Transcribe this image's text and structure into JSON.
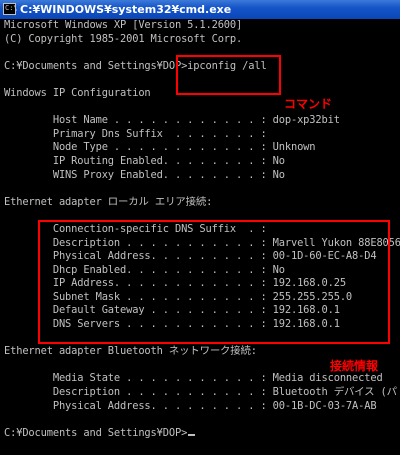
{
  "window": {
    "title": "C:¥WINDOWS¥system32¥cmd.exe",
    "icon": "cmd-console-icon",
    "icon_text": "C:\\"
  },
  "colors": {
    "titlebar": "#0a46b8",
    "console_background": "#000000",
    "console_text": "#c0c0c0",
    "annotation": "#ff0000"
  },
  "console": {
    "lines": [
      "Microsoft Windows XP [Version 5.1.2600]",
      "(C) Copyright 1985-2001 Microsoft Corp.",
      "",
      "C:¥Documents and Settings¥DOP>ipconfig /all",
      "",
      "Windows IP Configuration",
      "",
      "        Host Name . . . . . . . . . . . . : dop-xp32bit",
      "        Primary Dns Suffix  . . . . . . . :",
      "        Node Type . . . . . . . . . . . . : Unknown",
      "        IP Routing Enabled. . . . . . . . : No",
      "        WINS Proxy Enabled. . . . . . . . : No",
      "",
      "Ethernet adapter ローカル エリア接続:",
      "",
      "        Connection-specific DNS Suffix  . :",
      "        Description . . . . . . . . . . . : Marvell Yukon 88E8056",
      "        Physical Address. . . . . . . . . : 00-1D-60-EC-A8-D4",
      "        Dhcp Enabled. . . . . . . . . . . : No",
      "        IP Address. . . . . . . . . . . . : 192.168.0.25",
      "        Subnet Mask . . . . . . . . . . . : 255.255.255.0",
      "        Default Gateway . . . . . . . . . : 192.168.0.1",
      "        DNS Servers . . . . . . . . . . . : 192.168.0.1",
      "",
      "Ethernet adapter Bluetooth ネットワーク接続:",
      "",
      "        Media State . . . . . . . . . . . : Media disconnected",
      "        Description . . . . . . . . . . . : Bluetooth デバイス (パ",
      "        Physical Address. . . . . . . . . : 00-1B-DC-03-7A-AB",
      "",
      "C:¥Documents and Settings¥DOP>"
    ]
  },
  "annotations": {
    "command_label": "コマンド",
    "connection_info_label": "接続情報"
  }
}
